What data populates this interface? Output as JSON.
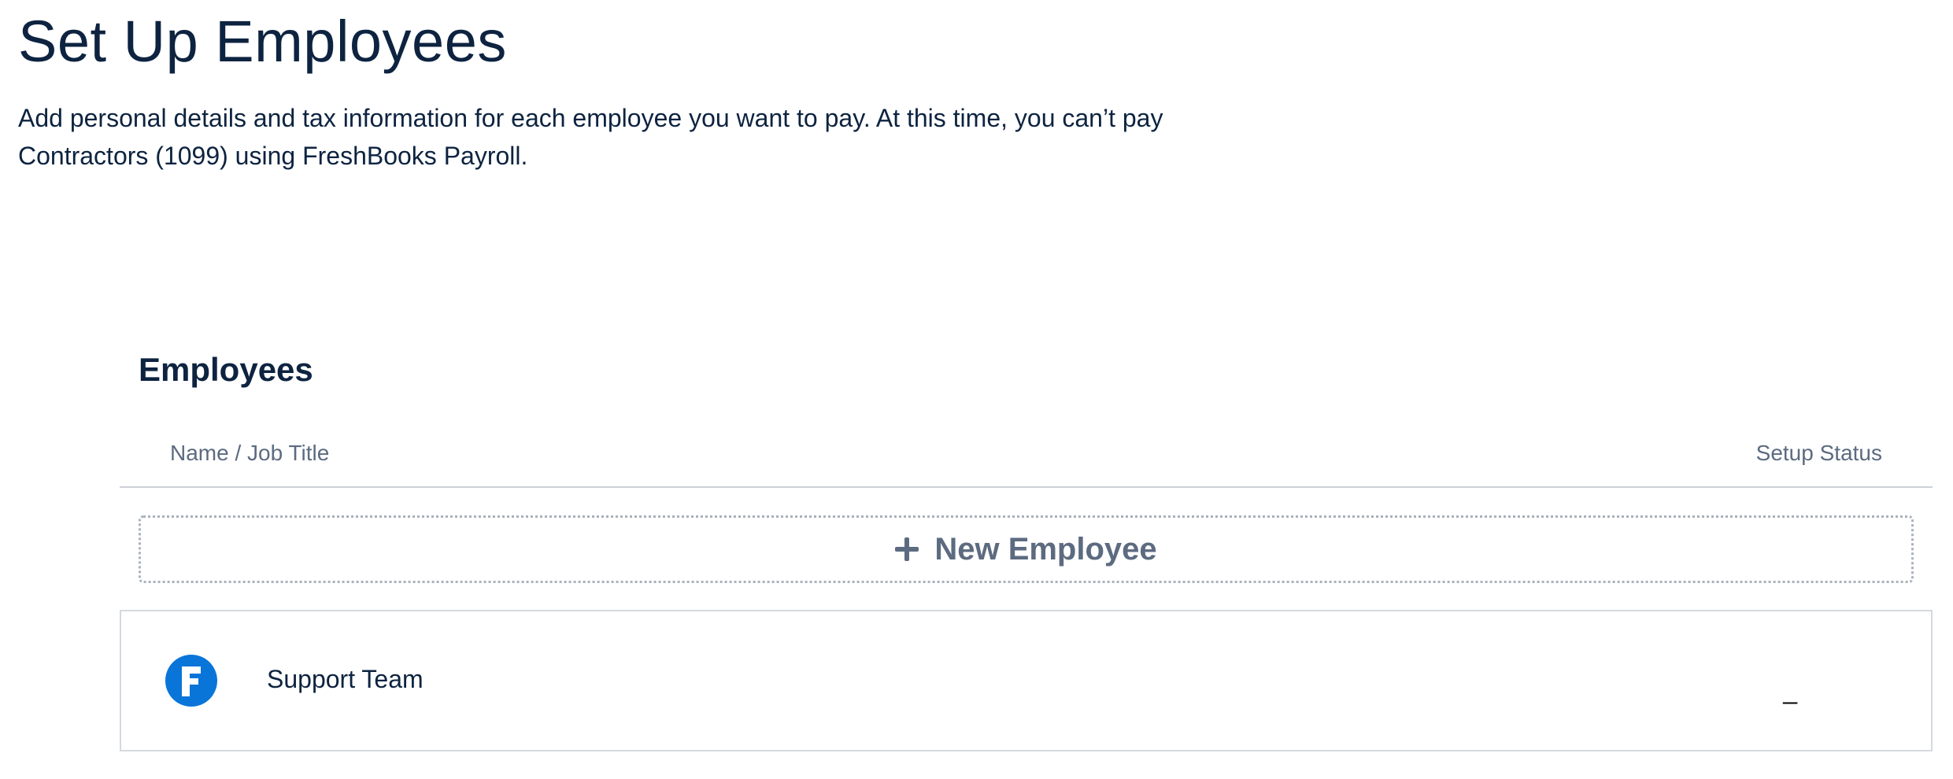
{
  "page": {
    "title": "Set Up Employees",
    "intro": "Add personal details and tax information for each employee you want to pay. At this time, you can’t pay Contractors (1099) using FreshBooks Payroll."
  },
  "employees": {
    "section_title": "Employees",
    "columns": {
      "name": "Name / Job Title",
      "status": "Setup Status"
    },
    "new_button_label": "New Employee",
    "rows": [
      {
        "name": "Support Team",
        "status": "_",
        "avatar_icon": "freshbooks-logo-icon"
      }
    ]
  },
  "colors": {
    "heading": "#0d2340",
    "muted": "#5c6b80",
    "brand_blue": "#0a75d8",
    "border": "#d5d9de"
  }
}
